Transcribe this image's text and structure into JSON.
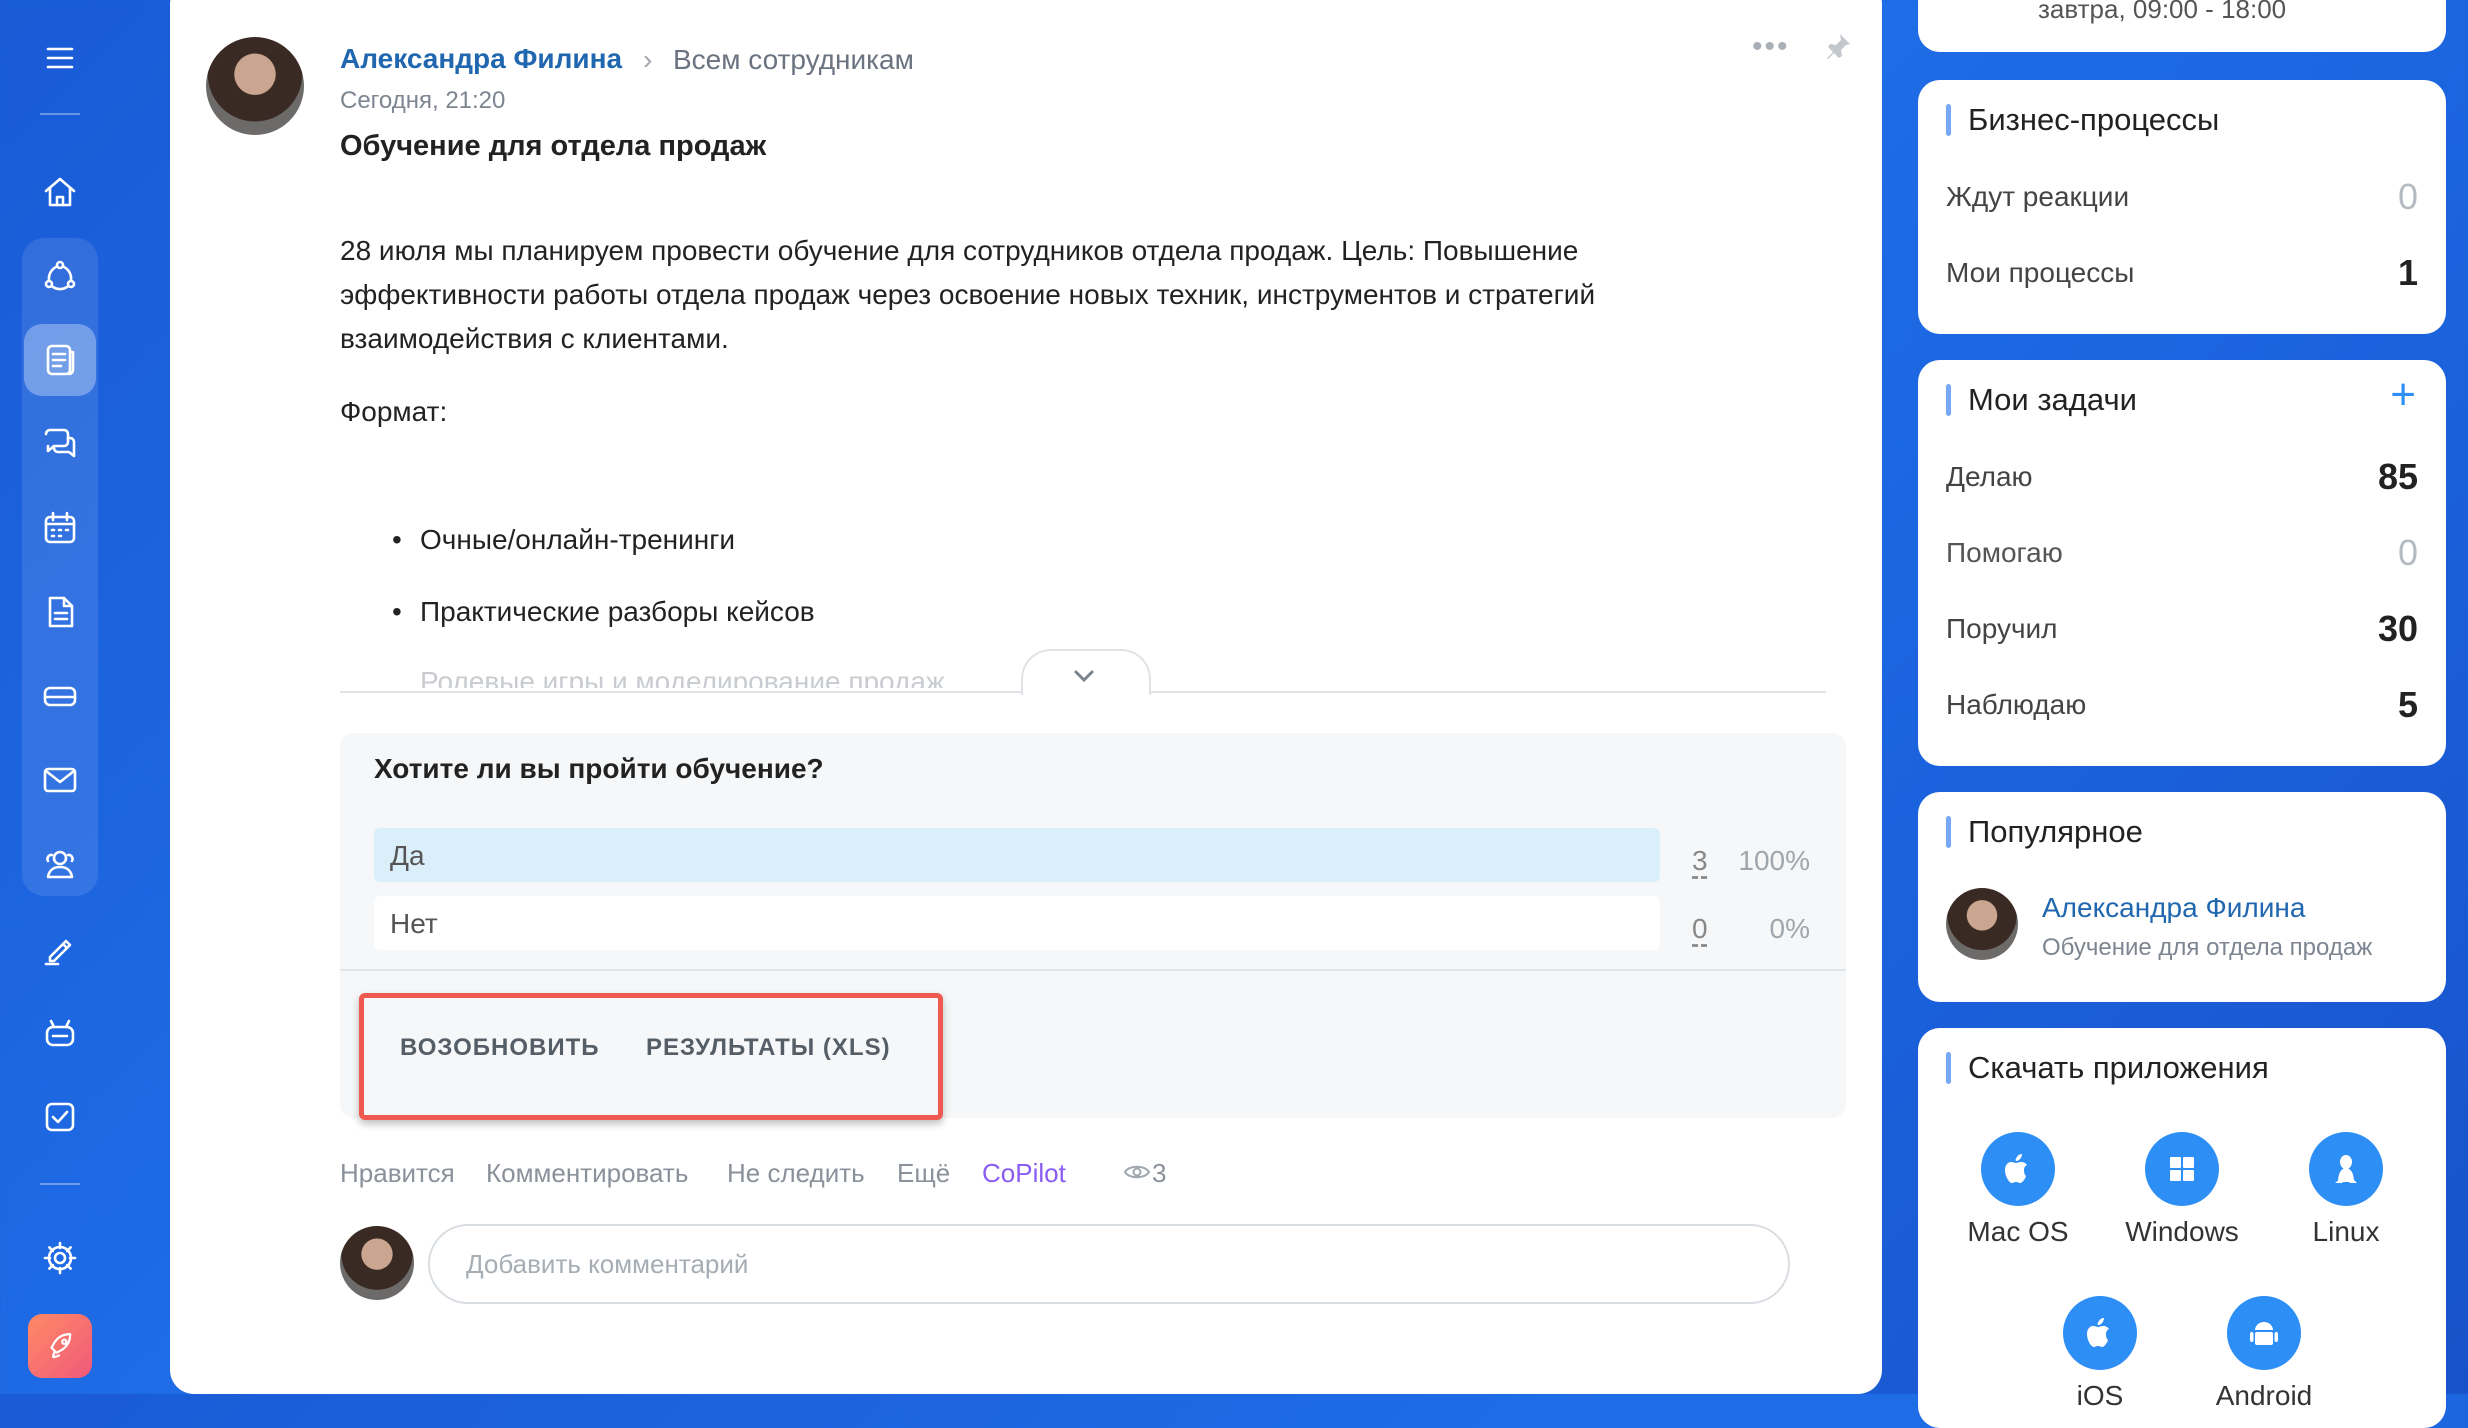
{
  "post": {
    "author": "Александра Филина",
    "audience": "Всем сотрудникам",
    "time": "Сегодня, 21:20",
    "title": "Обучение для отдела продаж",
    "paragraph": "28 июля мы планируем провести обучение для сотрудников отдела продаж. Цель: Повышение эффективности работы отдела продаж через освоение новых техник, инструментов и стратегий взаимодействия с клиентами.",
    "format_label": "Формат:",
    "bullets": [
      "Очные/онлайн-тренинги",
      "Практические разборы кейсов"
    ],
    "faded_line": "Ролевые игры и моделирование продаж"
  },
  "poll": {
    "question": "Хотите ли вы пройти обучение?",
    "answers": [
      {
        "label": "Да",
        "count": "3",
        "percent": "100%",
        "share": 1.0
      },
      {
        "label": "Нет",
        "count": "0",
        "percent": "0%",
        "share": 0.0
      }
    ],
    "resume_button": "ВОЗОБНОВИТЬ",
    "results_button": "РЕЗУЛЬТАТЫ (XLS)"
  },
  "actions": {
    "like": "Нравится",
    "comment": "Комментировать",
    "unfollow": "Не следить",
    "more": "Ещё",
    "copilot": "CoPilot",
    "views": "3"
  },
  "comment": {
    "placeholder": "Добавить комментарий"
  },
  "widgets": {
    "top_partial": "завтра, 09:00 - 18:00",
    "bp": {
      "title": "Бизнес-процессы",
      "rows": [
        {
          "label": "Ждут реакции",
          "value": "0"
        },
        {
          "label": "Мои процессы",
          "value": "1"
        }
      ]
    },
    "tasks": {
      "title": "Мои задачи",
      "add": "+",
      "rows": [
        {
          "label": "Делаю",
          "value": "85"
        },
        {
          "label": "Помогаю",
          "value": "0"
        },
        {
          "label": "Поручил",
          "value": "30"
        },
        {
          "label": "Наблюдаю",
          "value": "5"
        }
      ]
    },
    "popular": {
      "title": "Популярное",
      "author": "Александра Филина",
      "post": "Обучение для отдела продаж"
    },
    "apps": {
      "title": "Скачать приложения",
      "items": [
        "Mac OS",
        "Windows",
        "Linux",
        "iOS",
        "Android"
      ]
    }
  },
  "colors": {
    "accent": "#2067b0",
    "highlight": "#ee5a4f",
    "copilot": "#8a5cf5",
    "poll_fill": "#dbeffa"
  }
}
